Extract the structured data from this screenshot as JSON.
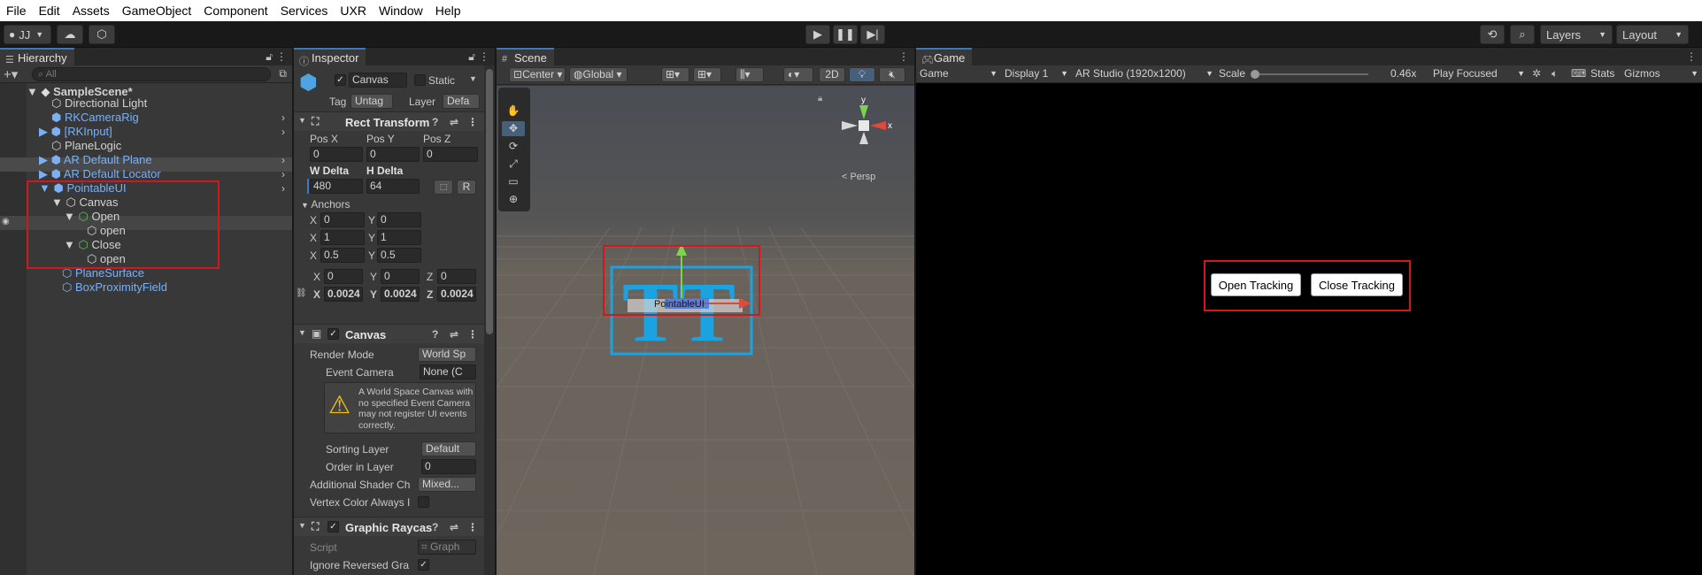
{
  "menu": [
    "File",
    "Edit",
    "Assets",
    "GameObject",
    "Component",
    "Services",
    "UXR",
    "Window",
    "Help"
  ],
  "toolbar": {
    "account": "JJ",
    "layers": "Layers",
    "layout": "Layout"
  },
  "hierarchy": {
    "tab": "Hierarchy",
    "search_placeholder": "All",
    "items": [
      {
        "label": "SampleScene*"
      },
      {
        "label": "Directional Light"
      },
      {
        "label": "RKCameraRig"
      },
      {
        "label": "[RKInput]"
      },
      {
        "label": "PlaneLogic"
      },
      {
        "label": "AR Default Plane"
      },
      {
        "label": "AR Default Locator"
      },
      {
        "label": "PointableUI"
      },
      {
        "label": "Canvas"
      },
      {
        "label": "Open"
      },
      {
        "label": "open"
      },
      {
        "label": "Close"
      },
      {
        "label": "open"
      },
      {
        "label": "PlaneSurface"
      },
      {
        "label": "BoxProximityField"
      }
    ]
  },
  "inspector": {
    "tab": "Inspector",
    "object_name": "Canvas",
    "static_label": "Static",
    "tag_label": "Tag",
    "tag_value": "Untag",
    "layer_label": "Layer",
    "layer_value": "Defa",
    "rect_transform": {
      "title": "Rect Transform",
      "pos_x_label": "Pos X",
      "pos_y_label": "Pos Y",
      "pos_z_label": "Pos Z",
      "pos_x": "0",
      "pos_y": "0",
      "pos_z": "0",
      "w_delta_label": "W Delta",
      "h_delta_label": "H Delta",
      "w_delta": "480",
      "h_delta": "64",
      "r_button": "R",
      "anchors_label": "Anchors",
      "min_x": "0",
      "min_y": "0",
      "max_x": "1",
      "max_y": "1",
      "pivot_x": "0.5",
      "pivot_y": "0.5",
      "rot_x": "0",
      "rot_y": "0",
      "rot_z": "0",
      "scale_x": "0.0024",
      "scale_y": "0.0024",
      "scale_z": "0.0024"
    },
    "canvas": {
      "title": "Canvas",
      "render_mode_label": "Render Mode",
      "render_mode": "World Sp",
      "event_camera_label": "Event Camera",
      "event_camera": "None (C",
      "warning": "A World Space Canvas with no specified Event Camera may not register UI events correctly.",
      "sorting_layer_label": "Sorting Layer",
      "sorting_layer": "Default",
      "order_label": "Order in Layer",
      "order": "0",
      "shader_label": "Additional Shader Ch",
      "shader": "Mixed...",
      "vertex_label": "Vertex Color Always I"
    },
    "raycaster": {
      "title": "Graphic Raycas",
      "script_label": "Script",
      "script": "Graph",
      "ignore_label": "Ignore Reversed Gra"
    }
  },
  "scene": {
    "tab": "Scene",
    "pivot": "Center",
    "space": "Global",
    "mode_2d": "2D",
    "persp": "< Persp",
    "axis_x": "x",
    "axis_y": "y",
    "pointable_label": "PointableUI"
  },
  "game": {
    "tab": "Game",
    "mode": "Game",
    "display": "Display 1",
    "resolution": "AR Studio (1920x1200)",
    "scale_label": "Scale",
    "scale_value": "0.46x",
    "play_focused": "Play Focused",
    "stats": "Stats",
    "gizmos": "Gizmos",
    "scale_fraction": 0.0,
    "buttons": [
      {
        "label": "Open Tracking"
      },
      {
        "label": "Close Tracking"
      }
    ]
  },
  "colors": {
    "accent": "#3a79bb",
    "highlight_red": "#d0191d",
    "hierarchy_blue": "#7bb0f5",
    "gizmo_cyan": "#1aa3e0"
  }
}
